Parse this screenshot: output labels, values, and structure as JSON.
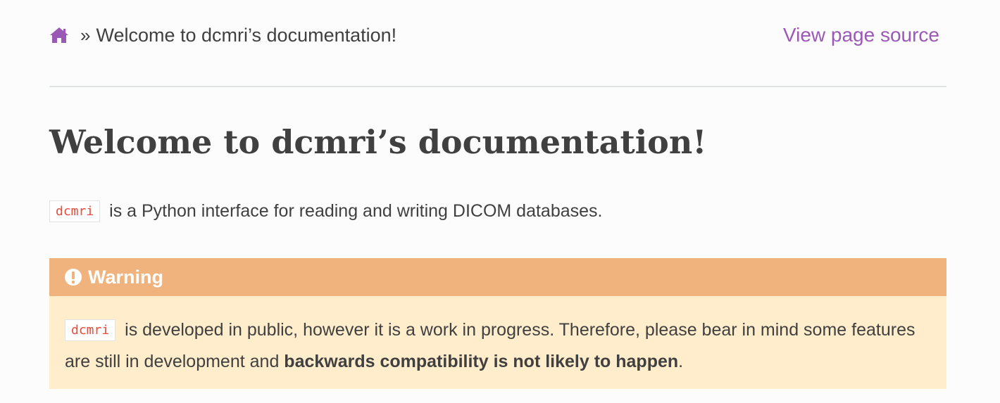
{
  "colors": {
    "link": "#9b59b6",
    "literal": "#e74c3c",
    "warning_header": "#f0b37e",
    "warning_body": "#ffedcc",
    "text": "#404040"
  },
  "breadcrumbs": {
    "home_icon": "home-icon",
    "separator": "»",
    "current": "Welcome to dcmri’s documentation!",
    "view_source": "View page source"
  },
  "main": {
    "title": "Welcome to dcmri’s documentation!",
    "intro": {
      "code": "dcmri",
      "text": " is a Python interface for reading and writing DICOM databases."
    },
    "warning": {
      "icon": "exclamation-circle-icon",
      "title": "Warning",
      "code": "dcmri",
      "text_before": " is developed in public, however it is a work in progress. Therefore, please bear in mind some features are still in development and ",
      "bold": "backwards compatibility is not likely to happen",
      "text_after": "."
    }
  }
}
